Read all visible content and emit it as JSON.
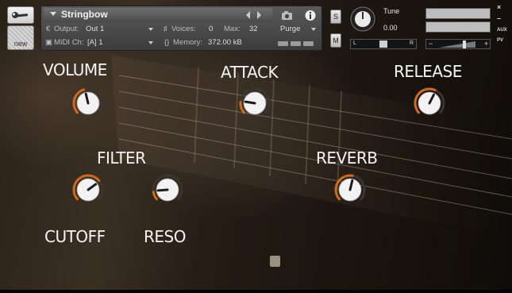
{
  "header": {
    "instrument_name": "Stringbow",
    "output_label": "Output:",
    "output_value": "Out 1",
    "midi_label": "MIDI Ch:",
    "midi_value": "[A] 1",
    "voices_label": "Voices:",
    "voices_value": "0",
    "max_label": "Max:",
    "max_value": "32",
    "memory_label": "Memory:",
    "memory_value": "372.00 kB",
    "purge_label": "Purge",
    "solo_label": "S",
    "mute_label": "M",
    "tune_label": "Tune",
    "tune_value": "0.00",
    "pan_left": "L",
    "pan_right": "R",
    "vol_minus": "−",
    "vol_plus": "+",
    "close_label": "×",
    "minimize_label": "–",
    "aux_label": "AUX",
    "pv_label": "PV",
    "new_label": "new"
  },
  "controls": {
    "volume": {
      "label": "VOLUME",
      "value_fraction": 0.45
    },
    "attack": {
      "label": "ATTACK",
      "value_fraction": 0.2
    },
    "release": {
      "label": "RELEASE",
      "value_fraction": 0.6
    },
    "filter_label": "FILTER",
    "reverb": {
      "label": "REVERB",
      "value_fraction": 0.55
    },
    "cutoff": {
      "label": "CUTOFF",
      "value_fraction": 0.7
    },
    "reso": {
      "label": "RESO",
      "value_fraction": 0.15
    }
  },
  "colors": {
    "accent": "#d06a1c",
    "label": "#f4f4f4"
  },
  "icons": {
    "wrench": "wrench-icon",
    "camera": "camera-icon",
    "info": "info-icon"
  }
}
